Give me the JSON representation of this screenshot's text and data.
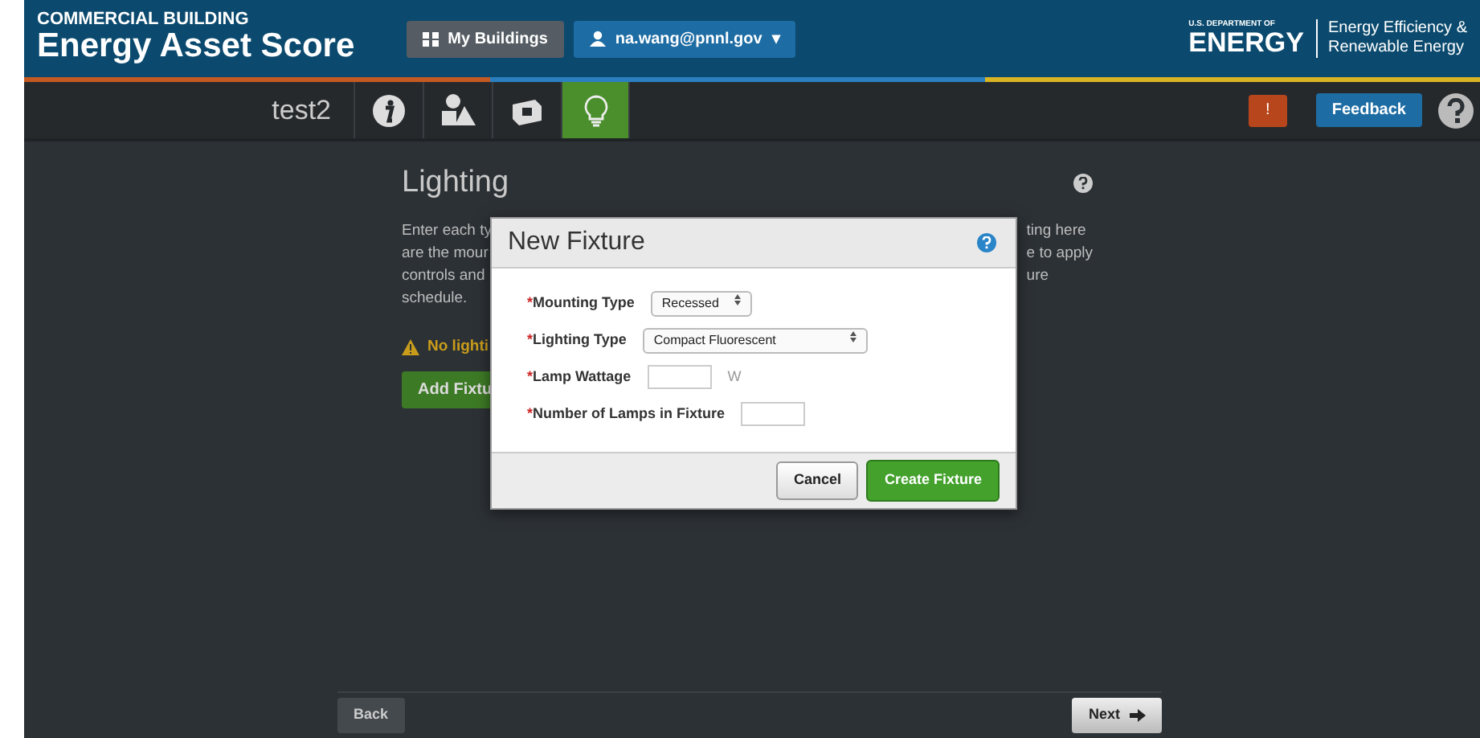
{
  "header": {
    "eyebrow": "COMMERCIAL BUILDING",
    "title": "Energy Asset Score",
    "my_buildings": "My Buildings",
    "user": "na.wang@pnnl.gov",
    "caret": "▾",
    "doe_small": "U.S. DEPARTMENT OF",
    "doe_big": "ENERGY",
    "eere": [
      "Energy Efficiency &",
      "Renewable Energy"
    ]
  },
  "nav": {
    "building_name": "test2",
    "tabs": [
      {
        "kind": "info",
        "selected": false
      },
      {
        "kind": "shapes",
        "selected": false
      },
      {
        "kind": "box",
        "selected": false
      },
      {
        "kind": "bulb",
        "selected": true
      }
    ],
    "alert": "!",
    "feedback": "Feedback"
  },
  "page": {
    "title": "Lighting",
    "intro_left": [
      "Enter each ty",
      "are the mour",
      "controls and",
      "schedule."
    ],
    "intro_right": [
      "ting here",
      "e to apply",
      "ure"
    ],
    "warning": "No lighti",
    "add_button": "Add Fixtu"
  },
  "dialog": {
    "title": "New Fixture",
    "fields": [
      {
        "kind": "select",
        "required_mark": "*",
        "label": "Mounting Type",
        "value": "Recessed"
      },
      {
        "kind": "select",
        "required_mark": "*",
        "label": "Lighting Type",
        "value": "Compact Fluorescent"
      },
      {
        "kind": "input",
        "required_mark": "*",
        "label": "Lamp Wattage",
        "unit": "W"
      },
      {
        "kind": "input",
        "required_mark": "*",
        "label": "Number of Lamps in Fixture"
      }
    ],
    "cancel": "Cancel",
    "create": "Create Fixture"
  },
  "footer": {
    "back": "Back",
    "next": "Next"
  }
}
